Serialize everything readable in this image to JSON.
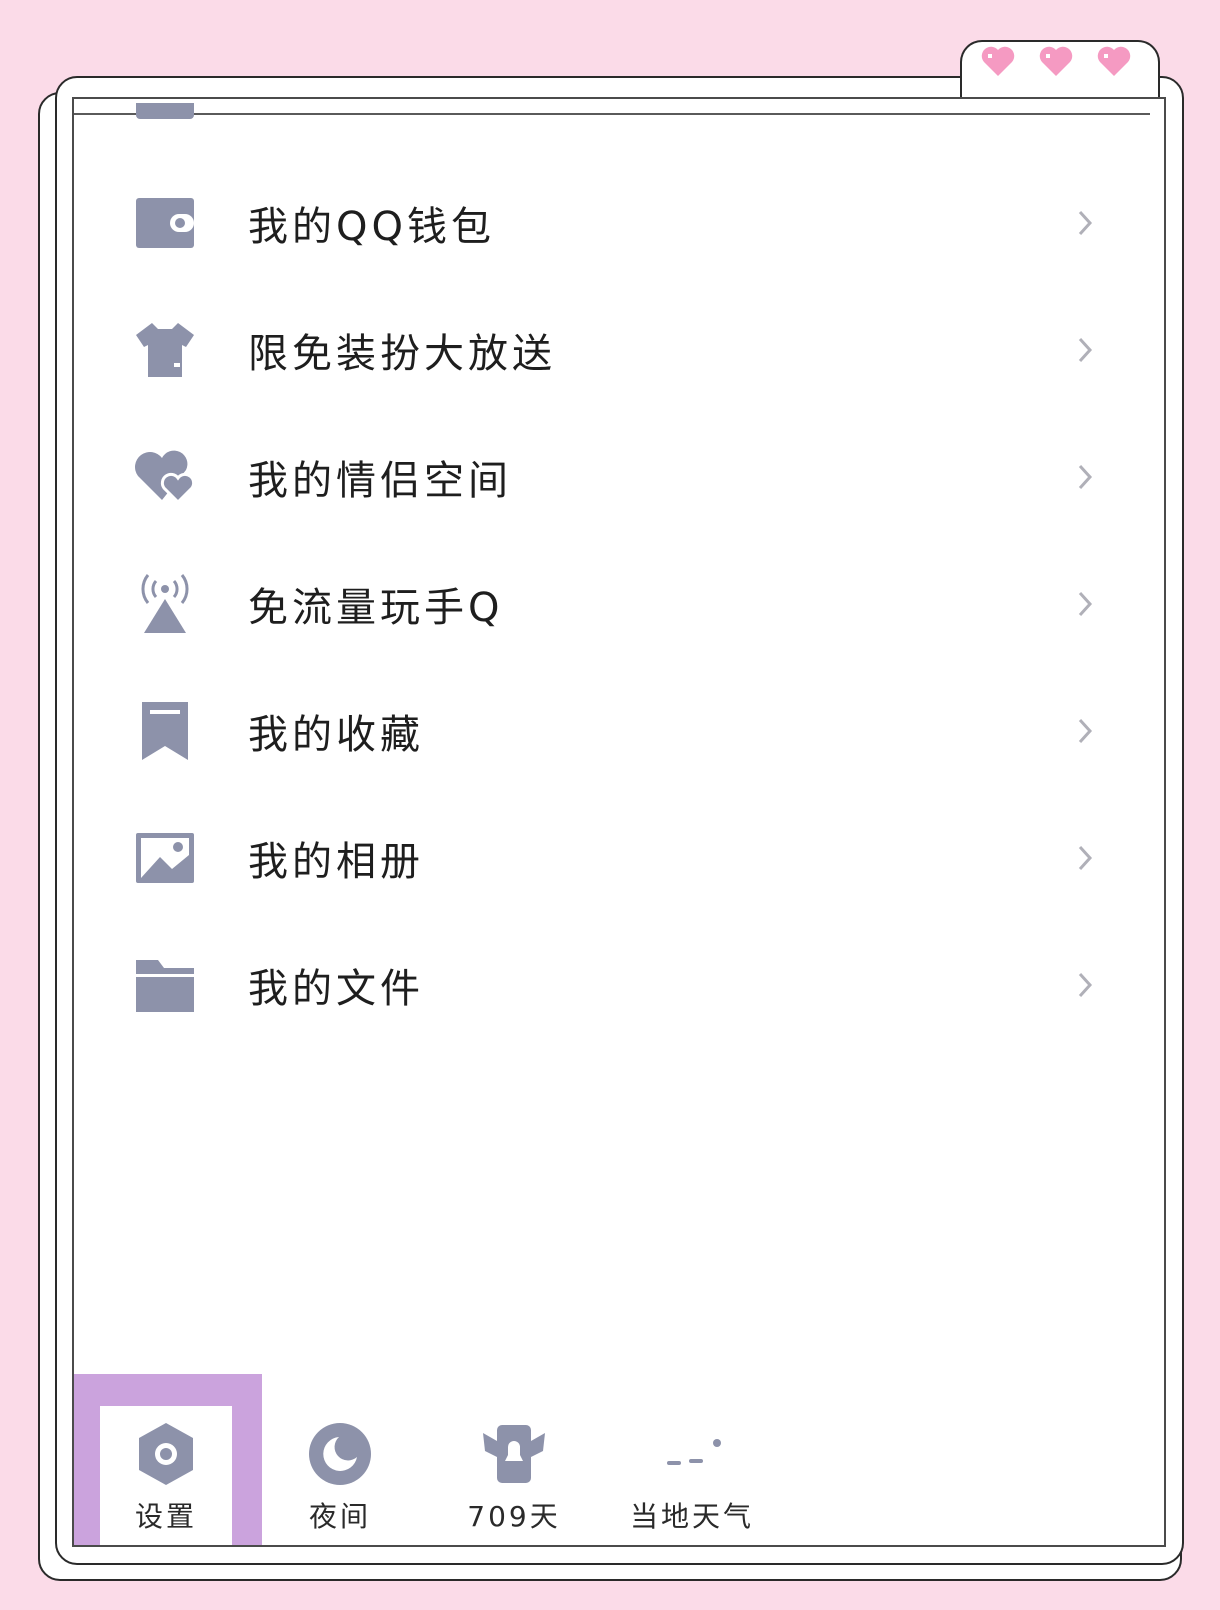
{
  "colors": {
    "background": "#fbdbe8",
    "icon": "#8d92aa",
    "highlight": "#cba3dd",
    "heart": "#f59ac2"
  },
  "menu": {
    "items": [
      {
        "label": "我的QQ钱包",
        "icon": "wallet-icon"
      },
      {
        "label": "限免装扮大放送",
        "icon": "tshirt-icon"
      },
      {
        "label": "我的情侣空间",
        "icon": "couple-hearts-icon"
      },
      {
        "label": "免流量玩手Q",
        "icon": "signal-tower-icon"
      },
      {
        "label": "我的收藏",
        "icon": "bookmark-icon"
      },
      {
        "label": "我的相册",
        "icon": "photo-album-icon"
      },
      {
        "label": "我的文件",
        "icon": "folder-icon"
      }
    ]
  },
  "bottom_bar": {
    "items": [
      {
        "label": "设置",
        "icon": "settings-icon"
      },
      {
        "label": "夜间",
        "icon": "night-mode-icon"
      },
      {
        "label": "709天",
        "icon": "qq-days-icon"
      },
      {
        "label": "当地天气",
        "icon": "weather-icon"
      }
    ]
  }
}
